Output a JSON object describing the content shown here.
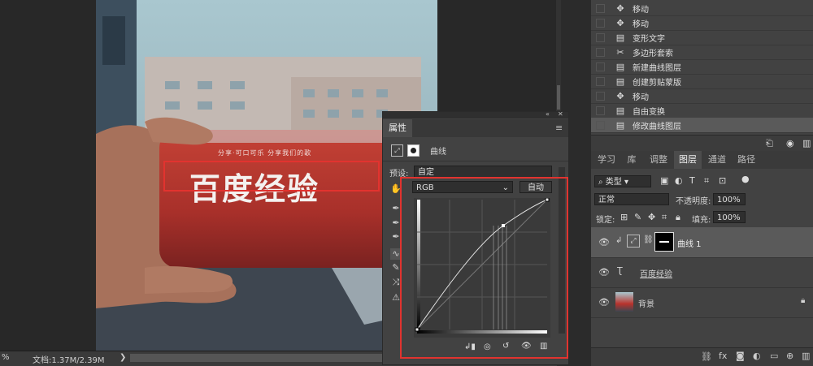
{
  "status": {
    "zoom": "%",
    "doc_info": "文档:1.37M/2.39M",
    "arrow": "❯"
  },
  "photo": {
    "can_brand_line": "分享·可口可乐 分享我们的歌",
    "can_text": "百度经验"
  },
  "history": {
    "items": [
      {
        "icon": "move-icon",
        "glyph": "✥",
        "label": "移动"
      },
      {
        "icon": "move-icon",
        "glyph": "✥",
        "label": "移动"
      },
      {
        "icon": "doc-icon",
        "glyph": "▤",
        "label": "变形文字"
      },
      {
        "icon": "lasso-icon",
        "glyph": "✂",
        "label": "多边形套索"
      },
      {
        "icon": "doc-icon",
        "glyph": "▤",
        "label": "新建曲线图层"
      },
      {
        "icon": "doc-icon",
        "glyph": "▤",
        "label": "创建剪贴蒙版"
      },
      {
        "icon": "move-icon",
        "glyph": "✥",
        "label": "移动"
      },
      {
        "icon": "doc-icon",
        "glyph": "▤",
        "label": "自由变换"
      },
      {
        "icon": "doc-icon",
        "glyph": "▤",
        "label": "修改曲线图层"
      }
    ]
  },
  "layers_panel": {
    "tabs": [
      "学习",
      "库",
      "调整",
      "图层",
      "通道",
      "路径"
    ],
    "active_tab": "图层",
    "filter_label": "类型",
    "blend_mode": "正常",
    "opacity_label": "不透明度:",
    "opacity_value": "100%",
    "lock_label": "锁定:",
    "fill_label": "填充:",
    "fill_value": "100%",
    "layers": [
      {
        "name": "曲线 1",
        "type": "adjustment"
      },
      {
        "name": "百度经验",
        "type": "text"
      },
      {
        "name": "背景",
        "type": "image"
      }
    ]
  },
  "properties": {
    "tab_label": "属性",
    "adjustment_name": "曲线",
    "preset_label": "预设:",
    "preset_value": "自定",
    "channel_value": "RGB",
    "auto_button": "自动"
  },
  "colors": {
    "highlight": "#e2332f",
    "can_red": "#b9332c",
    "panel_bg": "#424242"
  }
}
